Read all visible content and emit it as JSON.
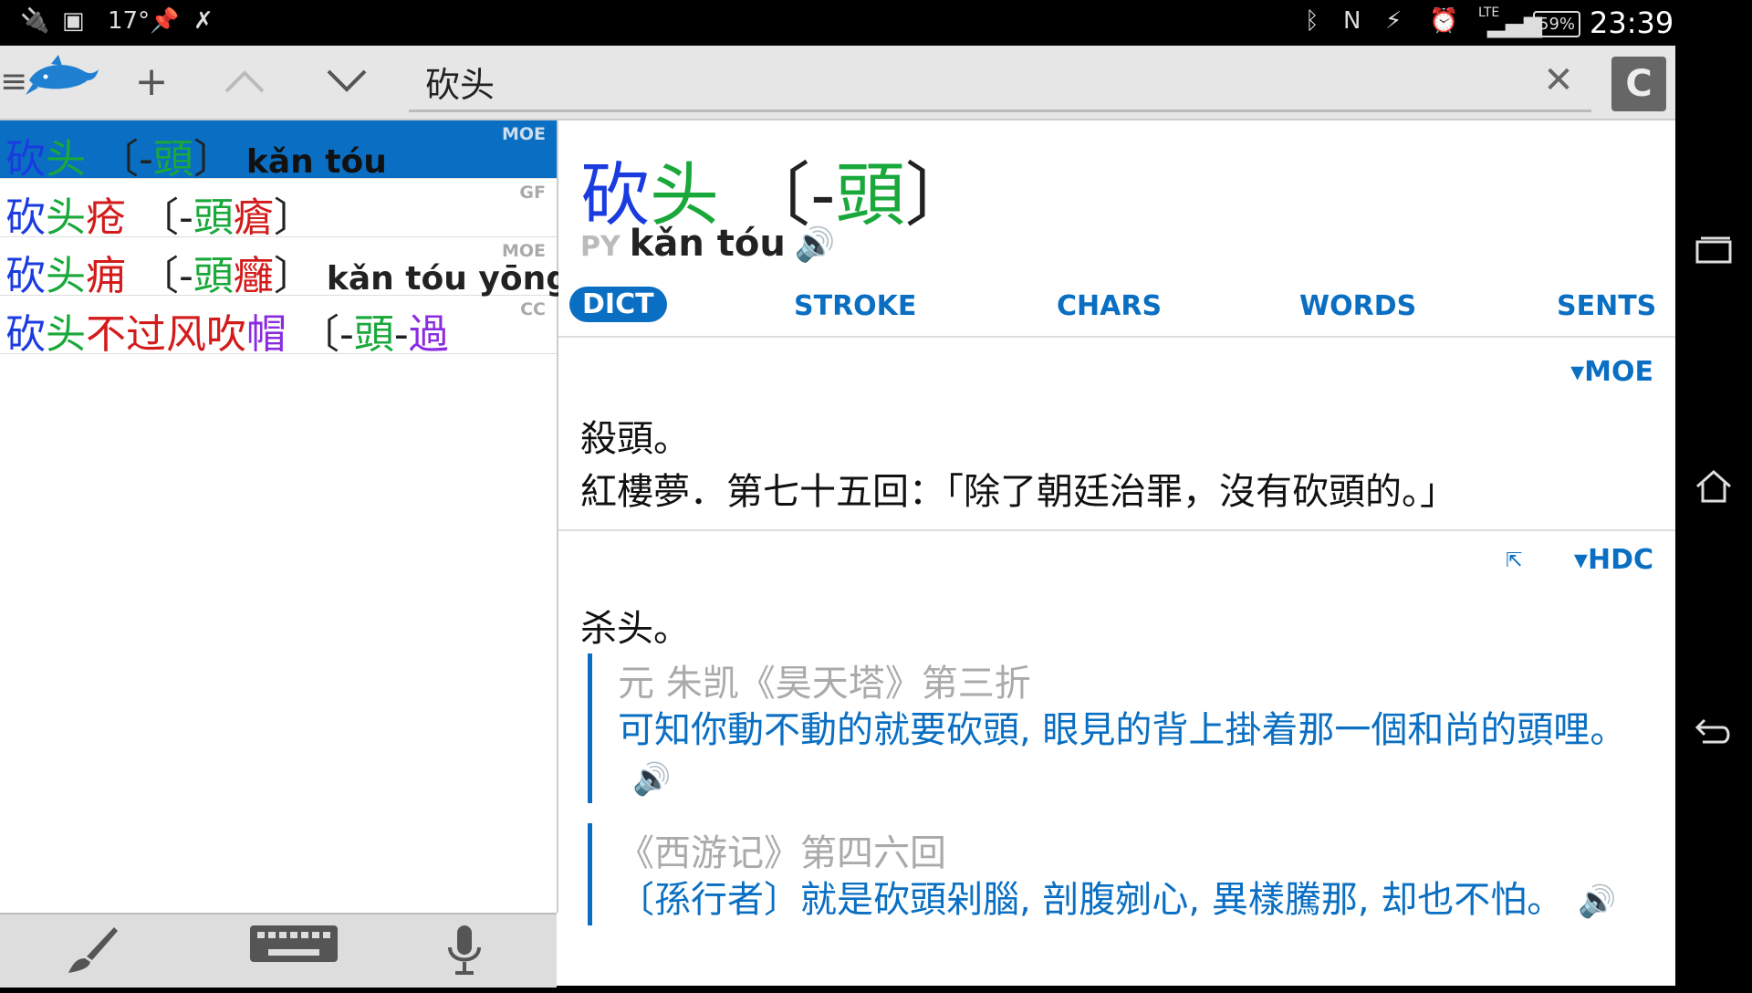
{
  "status_bar": {
    "left_icons": [
      "usb-icon",
      "image-icon",
      "pin-icon",
      "runner-icon"
    ],
    "temperature": "17°",
    "right_icons": [
      "bluetooth-icon",
      "nfc-icon",
      "vibrate-icon",
      "alarm-icon",
      "lte-signal-icon"
    ],
    "lte": "LTE",
    "battery": "59%",
    "time": "23:39"
  },
  "toolbar": {
    "menu_icon": "≡",
    "add_icon": "+",
    "up_icon": "^",
    "down_icon": "v",
    "search_value": "砍头",
    "search_placeholder": "",
    "clear_icon": "✕",
    "c_button": "C"
  },
  "results": [
    {
      "hanzi": [
        {
          "t": "砍",
          "c": "#1a3be0"
        },
        {
          "t": "头",
          "c": "#19a83a"
        },
        {
          "t": " 〔-",
          "c": "#222"
        },
        {
          "t": "頭",
          "c": "#19a83a"
        },
        {
          "t": "〕",
          "c": "#222"
        }
      ],
      "pinyin": "kǎn tóu",
      "source": "MOE",
      "selected": true
    },
    {
      "hanzi": [
        {
          "t": "砍",
          "c": "#1a3be0"
        },
        {
          "t": "头",
          "c": "#19a83a"
        },
        {
          "t": "疮",
          "c": "#d41b1b"
        },
        {
          "t": " 〔-",
          "c": "#222"
        },
        {
          "t": "頭",
          "c": "#19a83a"
        },
        {
          "t": "瘡",
          "c": "#d41b1b"
        },
        {
          "t": "〕",
          "c": "#222"
        }
      ],
      "pinyin": "",
      "source": "GF",
      "selected": false
    },
    {
      "hanzi": [
        {
          "t": "砍",
          "c": "#1a3be0"
        },
        {
          "t": "头",
          "c": "#19a83a"
        },
        {
          "t": "痈",
          "c": "#d41b1b"
        },
        {
          "t": " 〔-",
          "c": "#222"
        },
        {
          "t": "頭",
          "c": "#19a83a"
        },
        {
          "t": "癰",
          "c": "#d41b1b"
        },
        {
          "t": "〕",
          "c": "#222"
        }
      ],
      "pinyin": "kǎn tóu yōng",
      "source": "MOE",
      "selected": false
    },
    {
      "hanzi": [
        {
          "t": "砍",
          "c": "#1a3be0"
        },
        {
          "t": "头",
          "c": "#19a83a"
        },
        {
          "t": "不",
          "c": "#d41b1b"
        },
        {
          "t": "过",
          "c": "#d41b1b"
        },
        {
          "t": "风",
          "c": "#d41b1b"
        },
        {
          "t": "吹",
          "c": "#d41b1b"
        },
        {
          "t": "帽",
          "c": "#8a2be2"
        },
        {
          "t": " 〔-",
          "c": "#222"
        },
        {
          "t": "頭",
          "c": "#19a83a"
        },
        {
          "t": "-",
          "c": "#222"
        },
        {
          "t": "過",
          "c": "#8a2be2"
        }
      ],
      "pinyin": "",
      "source": "CC",
      "selected": false
    }
  ],
  "bottom_bar": {
    "icons": [
      "brush-icon",
      "keyboard-icon",
      "microphone-icon"
    ]
  },
  "entry": {
    "headword": [
      {
        "t": "砍",
        "c": "#1a3be0"
      },
      {
        "t": "头",
        "c": "#19a83a"
      },
      {
        "t": " 〔-",
        "c": "#222"
      },
      {
        "t": "頭",
        "c": "#19a83a"
      },
      {
        "t": "〕",
        "c": "#222"
      }
    ],
    "py_label": "PY",
    "pinyin": "kǎn tóu",
    "tabs": [
      "DICT",
      "STROKE",
      "CHARS",
      "WORDS",
      "SENTS"
    ],
    "active_tab": "DICT",
    "moe": {
      "label": "▾MOE",
      "lines": [
        "殺頭。",
        "紅樓夢．第七十五回：「除了朝廷治罪，沒有砍頭的。」"
      ]
    },
    "hdc": {
      "label": "▾HDC",
      "definition": "杀头。",
      "quotes": [
        {
          "source": "元 朱凯《昊天塔》第三折",
          "text": "可知你動不動的就要砍頭, 眼見的背上掛着那一個和尚的頭哩。"
        },
        {
          "source": "《西游记》第四六回",
          "text": "〔孫行者〕就是砍頭剁腦, 剖腹剜心, 異樣騰那, 却也不怕。"
        }
      ]
    }
  },
  "colors": {
    "accent": "#0a6fc2",
    "selected_row": "#0a6fc2"
  }
}
